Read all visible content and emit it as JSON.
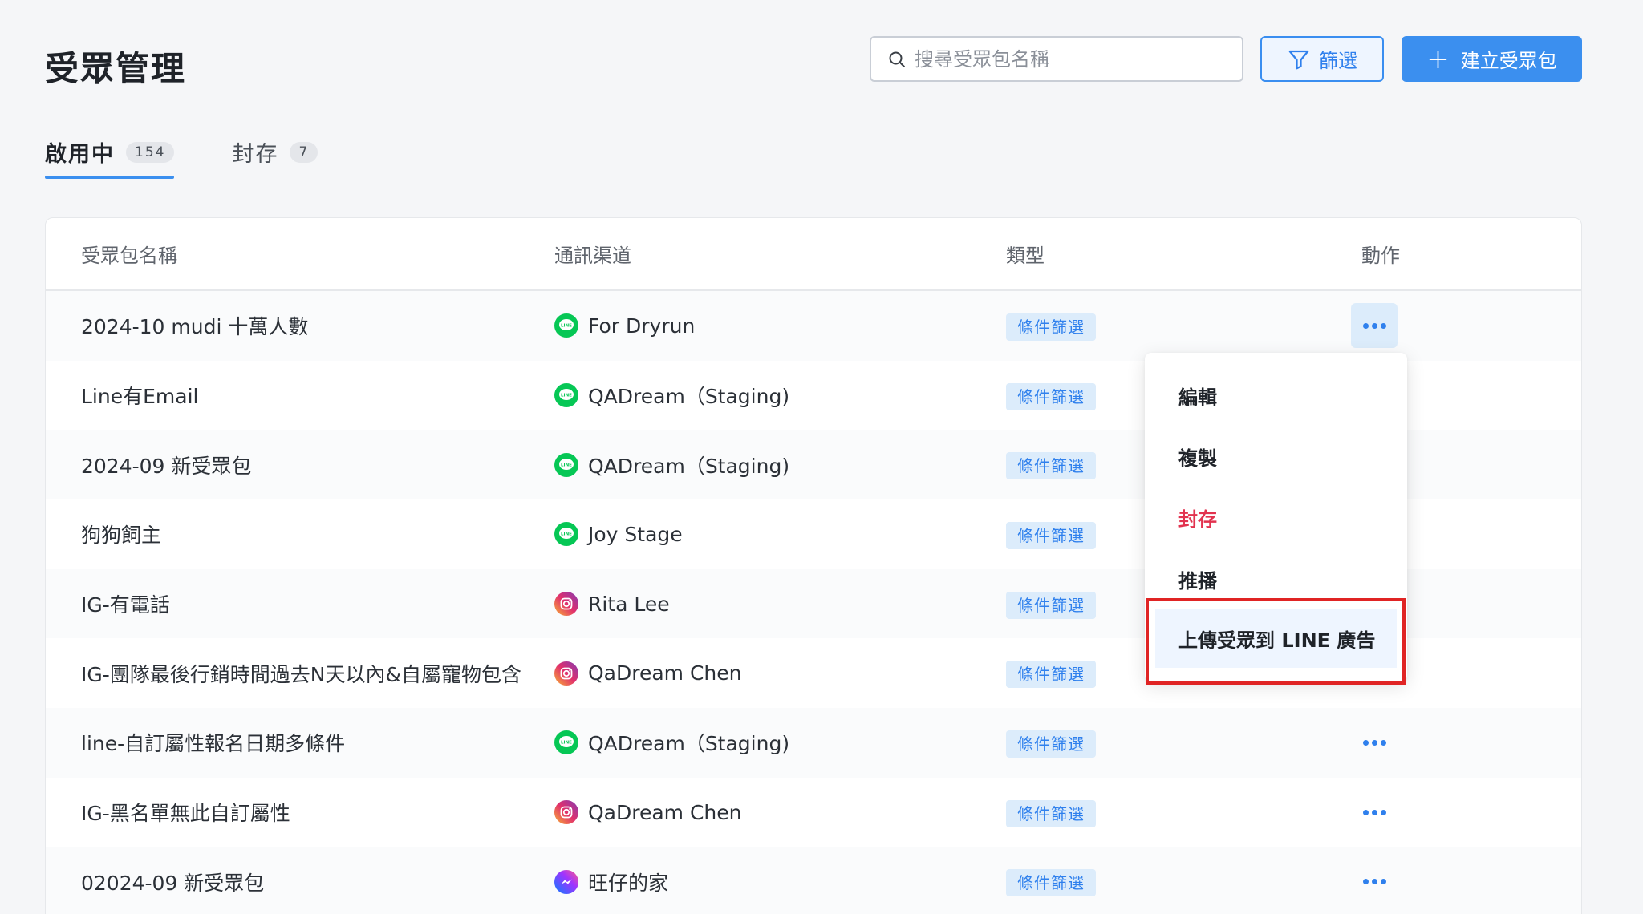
{
  "header": {
    "title": "受眾管理",
    "search_placeholder": "搜尋受眾包名稱",
    "filter_label": "篩選",
    "create_label": "建立受眾包"
  },
  "tabs": [
    {
      "label": "啟用中",
      "count": "154",
      "active": true
    },
    {
      "label": "封存",
      "count": "7",
      "active": false
    }
  ],
  "table": {
    "columns": [
      "受眾包名稱",
      "通訊渠道",
      "類型",
      "動作"
    ],
    "rows": [
      {
        "name": "2024-10 mudi 十萬人數",
        "channel_icon": "line-icon",
        "channel": "For Dryrun",
        "type": "條件篩選"
      },
      {
        "name": "Line有Email",
        "channel_icon": "line-icon",
        "channel": "QADream（Staging)",
        "type": "條件篩選"
      },
      {
        "name": "2024-09 新受眾包",
        "channel_icon": "line-icon",
        "channel": "QADream（Staging)",
        "type": "條件篩選"
      },
      {
        "name": "狗狗飼主",
        "channel_icon": "line-icon",
        "channel": "Joy Stage",
        "type": "條件篩選"
      },
      {
        "name": "IG-有電話",
        "channel_icon": "instagram-icon",
        "channel": "Rita Lee",
        "type": "條件篩選"
      },
      {
        "name": "IG-團隊最後行銷時間過去N天以內&自屬寵物包含",
        "channel_icon": "instagram-icon",
        "channel": "QaDream Chen",
        "type": "條件篩選"
      },
      {
        "name": "line-自訂屬性報名日期多條件",
        "channel_icon": "line-icon",
        "channel": "QADream（Staging)",
        "type": "條件篩選"
      },
      {
        "name": "IG-黑名單無此自訂屬性",
        "channel_icon": "instagram-icon",
        "channel": "QaDream Chen",
        "type": "條件篩選"
      },
      {
        "name": "02024-09 新受眾包",
        "channel_icon": "messenger-icon",
        "channel": "旺仔的家",
        "type": "條件篩選"
      }
    ]
  },
  "dropdown": {
    "items": [
      "編輯",
      "複製",
      "封存",
      "推播",
      "上傳受眾到 LINE 廣告"
    ]
  },
  "colors": {
    "accent": "#3b8fef",
    "danger": "#e2334f",
    "line_green": "#06c755",
    "highlight_red": "#e02424"
  }
}
